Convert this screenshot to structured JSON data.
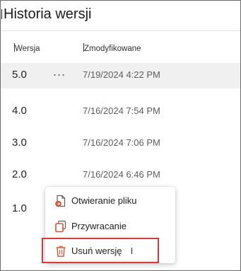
{
  "panel": {
    "title": "Historia wersji"
  },
  "columns": {
    "version": "Wersja",
    "modified": "Zmodyfikowane"
  },
  "rows": [
    {
      "version": "5.0",
      "modified": "7/19/2024 4:22 PM",
      "more": "..."
    },
    {
      "version": "4.0",
      "modified": "7/16/2024 7:54 PM"
    },
    {
      "version": "3.0",
      "modified": "7/16/2024 7:06 PM"
    },
    {
      "version": "2.0",
      "modified": "7/16/2024 6:46 PM"
    },
    {
      "version": "1.0",
      "modified": ""
    }
  ],
  "context_menu": {
    "items": [
      {
        "label": "Otwieranie pliku",
        "icon": "file-open-icon"
      },
      {
        "label": "Przywracanie",
        "icon": "restore-icon"
      },
      {
        "label": "Usuń wersję",
        "icon": "trash-icon"
      }
    ]
  },
  "colors": {
    "accent_orange": "#d35230",
    "highlight_red": "#d9383a",
    "selected_row": "#f0f0f0"
  }
}
